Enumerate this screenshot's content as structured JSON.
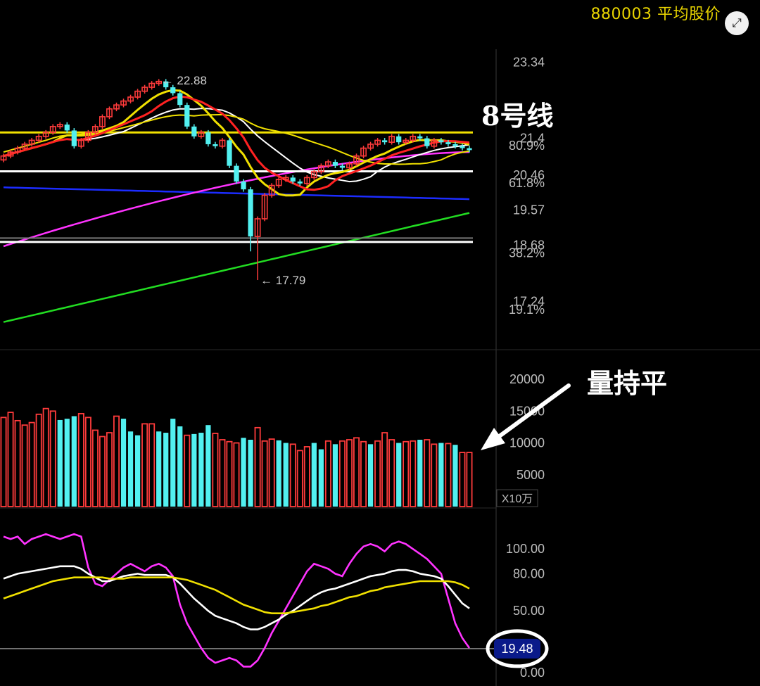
{
  "header": {
    "title": "880003 平均股价",
    "expand_icon": "expand-icon",
    "expand_glyph": "⤢"
  },
  "annotations": {
    "line_note": "8号线",
    "volume_note": "量持平",
    "volume_arrow_icon": "arrow-icon"
  },
  "colors": {
    "background": "#000000",
    "up_candle": "#ff3b3b",
    "down_candle": "#52f0f0",
    "ma_yellow": "#f0e000",
    "ma_red": "#ff2222",
    "ma_white": "#ffffff",
    "ma_magenta": "#ff33ff",
    "ma_blue": "#1c2cff",
    "ma_green": "#22dd22",
    "axis_text": "#bdbdbd",
    "axis_line": "#3a3a3a",
    "value_badge_bg": "#0a1a8a",
    "title": "#e8d400"
  },
  "chart_data": [
    {
      "type": "candlestick",
      "panel": "price",
      "ylim": [
        16.5,
        23.4
      ],
      "yticks": [
        {
          "value": 23.34,
          "label": "23.34"
        },
        {
          "value": 21.4,
          "label": "21.4"
        },
        {
          "value": 20.46,
          "label": "20.46"
        },
        {
          "value": 19.57,
          "label": "19.57"
        },
        {
          "value": 18.68,
          "label": "18.68"
        },
        {
          "value": 17.24,
          "label": "17.24"
        }
      ],
      "percent_labels": [
        {
          "value": 21.21,
          "label": "80.9%"
        },
        {
          "value": 20.26,
          "label": "61.8%"
        },
        {
          "value": 18.48,
          "label": "38.2%"
        },
        {
          "value": 17.04,
          "label": "19.1%"
        }
      ],
      "annotations": [
        {
          "index": 22,
          "value": 22.88,
          "label": "22.88"
        },
        {
          "index": 36,
          "value": 17.79,
          "label": "17.79"
        }
      ],
      "horizontal_levels": [
        {
          "value": 21.55,
          "color": "#f0e000"
        },
        {
          "value": 20.56,
          "color": "#ffffff"
        },
        {
          "value": 18.76,
          "color": "#ffffff"
        }
      ],
      "closes": [
        20.95,
        21.05,
        21.15,
        21.25,
        21.35,
        21.45,
        21.55,
        21.7,
        21.75,
        21.6,
        21.2,
        21.35,
        21.55,
        21.7,
        21.95,
        22.15,
        22.25,
        22.35,
        22.45,
        22.6,
        22.7,
        22.8,
        22.85,
        22.7,
        22.55,
        22.25,
        21.7,
        21.45,
        21.55,
        21.25,
        21.2,
        21.35,
        20.7,
        20.3,
        20.1,
        18.9,
        19.35,
        19.95,
        20.2,
        20.35,
        20.4,
        20.3,
        20.25,
        20.4,
        20.55,
        20.7,
        20.8,
        20.7,
        20.65,
        20.75,
        20.95,
        21.15,
        21.25,
        21.35,
        21.3,
        21.45,
        21.3,
        21.35,
        21.45,
        21.4,
        21.2,
        21.35,
        21.3,
        21.25,
        21.2,
        21.15,
        21.1
      ]
    },
    {
      "type": "bar",
      "panel": "volume",
      "unit": "X10万",
      "ylim": [
        0,
        21000
      ],
      "yticks": [
        {
          "value": 20000,
          "label": "20000"
        },
        {
          "value": 15000,
          "label": "15000"
        },
        {
          "value": 10000,
          "label": "10000"
        },
        {
          "value": 5000,
          "label": "5000"
        }
      ],
      "values": [
        14000,
        14800,
        13500,
        12800,
        13200,
        14500,
        15400,
        15000,
        13600,
        13800,
        14200,
        14600,
        14000,
        12000,
        11000,
        11600,
        14200,
        13800,
        11800,
        11200,
        13000,
        13000,
        11800,
        11600,
        13800,
        12600,
        11200,
        11400,
        11600,
        12800,
        11500,
        10500,
        10200,
        10000,
        10800,
        10500,
        12400,
        10300,
        10600,
        10400,
        10000,
        9800,
        8800,
        9400,
        10000,
        9000,
        10300,
        9800,
        10300,
        10500,
        10800,
        10200,
        9800,
        10300,
        11600,
        10500,
        10000,
        10200,
        10300,
        10500,
        10500,
        9800,
        10000,
        9900,
        9700,
        8500,
        8500
      ],
      "up": [
        1,
        1,
        1,
        1,
        1,
        1,
        1,
        1,
        0,
        0,
        0,
        1,
        1,
        1,
        1,
        1,
        1,
        0,
        0,
        0,
        1,
        1,
        0,
        0,
        0,
        0,
        1,
        0,
        0,
        0,
        1,
        1,
        1,
        1,
        0,
        0,
        1,
        1,
        1,
        0,
        0,
        1,
        1,
        1,
        0,
        0,
        1,
        0,
        1,
        1,
        1,
        1,
        0,
        1,
        1,
        1,
        0,
        1,
        1,
        0,
        1,
        1,
        0,
        1,
        0,
        1,
        1
      ]
    },
    {
      "type": "line",
      "panel": "oscillator",
      "ylim": [
        -5,
        120
      ],
      "yticks": [
        {
          "value": 100,
          "label": "100.00"
        },
        {
          "value": 80,
          "label": "80.00"
        },
        {
          "value": 50,
          "label": "50.00"
        },
        {
          "value": 0,
          "label": "0.00"
        }
      ],
      "reference_level": 19.48,
      "current_value_label": "19.48",
      "series": [
        {
          "color": "#ff33ff",
          "values": [
            110,
            108,
            110,
            104,
            108,
            110,
            112,
            110,
            108,
            110,
            112,
            110,
            85,
            72,
            70,
            75,
            80,
            85,
            88,
            85,
            82,
            86,
            88,
            85,
            78,
            55,
            40,
            30,
            20,
            12,
            8,
            10,
            12,
            10,
            5,
            5,
            10,
            20,
            32,
            42,
            52,
            62,
            72,
            82,
            88,
            86,
            84,
            80,
            78,
            88,
            96,
            102,
            104,
            102,
            98,
            104,
            106,
            104,
            100,
            96,
            92,
            86,
            80,
            60,
            40,
            28,
            20
          ]
        },
        {
          "color": "#ffffff",
          "values": [
            76,
            78,
            80,
            81,
            82,
            83,
            84,
            85,
            86,
            86,
            86,
            84,
            80,
            77,
            74,
            74,
            76,
            78,
            79,
            80,
            79,
            79,
            79,
            79,
            77,
            72,
            66,
            60,
            55,
            50,
            46,
            44,
            42,
            40,
            37,
            35,
            35,
            37,
            40,
            43,
            47,
            50,
            54,
            58,
            62,
            65,
            67,
            68,
            70,
            72,
            74,
            76,
            78,
            79,
            80,
            82,
            83,
            83,
            82,
            80,
            79,
            78,
            76,
            70,
            63,
            56,
            52
          ]
        },
        {
          "color": "#f0e000",
          "values": [
            60,
            62,
            64,
            66,
            68,
            70,
            72,
            74,
            75,
            76,
            77,
            77,
            77,
            77,
            77,
            76,
            76,
            76,
            77,
            77,
            77,
            77,
            77,
            77,
            77,
            76,
            75,
            73,
            71,
            69,
            67,
            64,
            61,
            58,
            55,
            53,
            51,
            49,
            48,
            48,
            48,
            49,
            50,
            51,
            52,
            54,
            55,
            57,
            59,
            61,
            62,
            64,
            66,
            67,
            69,
            70,
            71,
            72,
            73,
            74,
            74,
            74,
            74,
            74,
            73,
            71,
            68
          ]
        }
      ]
    }
  ]
}
